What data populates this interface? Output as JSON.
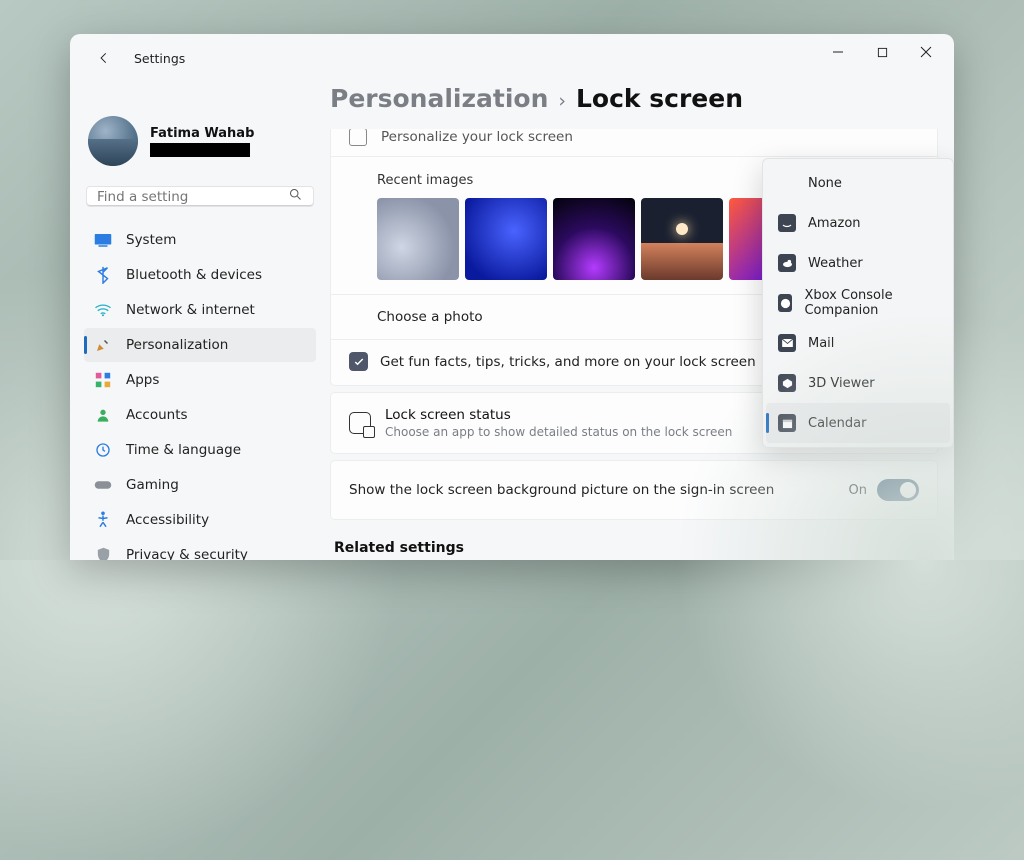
{
  "app": {
    "title": "Settings"
  },
  "profile": {
    "name": "Fatima Wahab"
  },
  "search": {
    "placeholder": "Find a setting"
  },
  "sidebar": {
    "items": [
      {
        "label": "System"
      },
      {
        "label": "Bluetooth & devices"
      },
      {
        "label": "Network & internet"
      },
      {
        "label": "Personalization"
      },
      {
        "label": "Apps"
      },
      {
        "label": "Accounts"
      },
      {
        "label": "Time & language"
      },
      {
        "label": "Gaming"
      },
      {
        "label": "Accessibility"
      },
      {
        "label": "Privacy & security"
      }
    ]
  },
  "breadcrumb": {
    "parent": "Personalization",
    "current": "Lock screen"
  },
  "personalize_peek": "Personalize your lock screen",
  "recent_label": "Recent images",
  "choose_label": "Choose a photo",
  "funfacts_label": "Get fun facts, tips, tricks, and more on your lock screen",
  "status": {
    "title": "Lock screen status",
    "sub": "Choose an app to show detailed status on the lock screen"
  },
  "signin_bg": {
    "label": "Show the lock screen background picture on the sign-in screen",
    "state": "On"
  },
  "related_heading": "Related settings",
  "flyout": {
    "items": [
      {
        "label": "None"
      },
      {
        "label": "Amazon"
      },
      {
        "label": "Weather"
      },
      {
        "label": "Xbox Console Companion"
      },
      {
        "label": "Mail"
      },
      {
        "label": "3D Viewer"
      },
      {
        "label": "Calendar"
      }
    ]
  }
}
